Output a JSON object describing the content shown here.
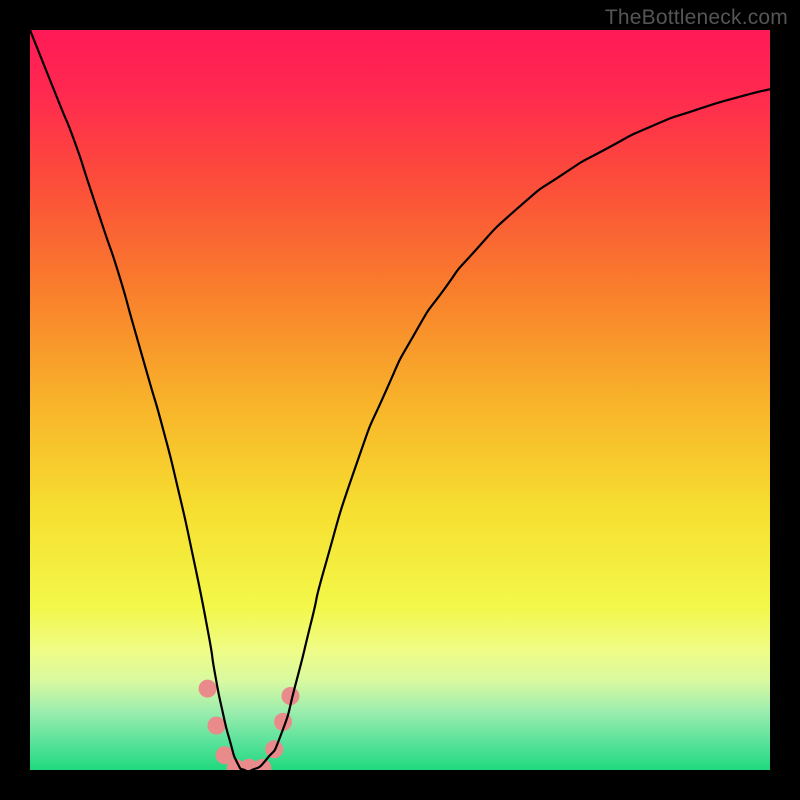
{
  "watermark": "TheBottleneck.com",
  "chart_data": {
    "type": "line",
    "title": "",
    "xlabel": "",
    "ylabel": "",
    "xlim": [
      0,
      100
    ],
    "ylim": [
      0,
      100
    ],
    "background_gradient": {
      "stops": [
        {
          "pos": 0.0,
          "color": "#ff1a57"
        },
        {
          "pos": 0.08,
          "color": "#ff2850"
        },
        {
          "pos": 0.2,
          "color": "#fc4b3b"
        },
        {
          "pos": 0.35,
          "color": "#f97e2c"
        },
        {
          "pos": 0.5,
          "color": "#f8b22a"
        },
        {
          "pos": 0.65,
          "color": "#f6df30"
        },
        {
          "pos": 0.78,
          "color": "#f3f84a"
        },
        {
          "pos": 0.84,
          "color": "#effc88"
        },
        {
          "pos": 0.88,
          "color": "#d8f9a0"
        },
        {
          "pos": 0.92,
          "color": "#9eedae"
        },
        {
          "pos": 0.96,
          "color": "#5de39c"
        },
        {
          "pos": 1.0,
          "color": "#1fd97f"
        }
      ]
    },
    "series": [
      {
        "name": "bottleneck-curve",
        "color": "#000000",
        "stroke_width": 2.2,
        "x": [
          0,
          2,
          4,
          6,
          8,
          10,
          12,
          14,
          16,
          18,
          20,
          22,
          24,
          25,
          26,
          27,
          28,
          29,
          30,
          32,
          34,
          36,
          38,
          40,
          44,
          48,
          52,
          56,
          60,
          66,
          72,
          78,
          84,
          90,
          96,
          100
        ],
        "y": [
          100,
          95,
          90,
          85,
          79,
          73,
          67,
          60,
          53,
          46,
          38,
          29,
          19,
          13,
          8,
          4,
          1,
          0,
          0,
          1.5,
          5,
          12,
          20,
          28,
          41,
          51,
          59,
          65,
          70,
          76,
          80.5,
          84,
          87,
          89.2,
          91,
          92
        ]
      }
    ],
    "markers": {
      "name": "flat-bottom-dots",
      "color": "#e98b8b",
      "radius": 9,
      "points": [
        {
          "x": 24.0,
          "y": 11.0
        },
        {
          "x": 25.2,
          "y": 6.0
        },
        {
          "x": 26.3,
          "y": 2.0
        },
        {
          "x": 27.8,
          "y": 0.3
        },
        {
          "x": 29.6,
          "y": 0.3
        },
        {
          "x": 31.4,
          "y": 0.3
        },
        {
          "x": 33.0,
          "y": 2.8
        },
        {
          "x": 34.2,
          "y": 6.5
        },
        {
          "x": 35.2,
          "y": 10.0
        }
      ]
    }
  }
}
